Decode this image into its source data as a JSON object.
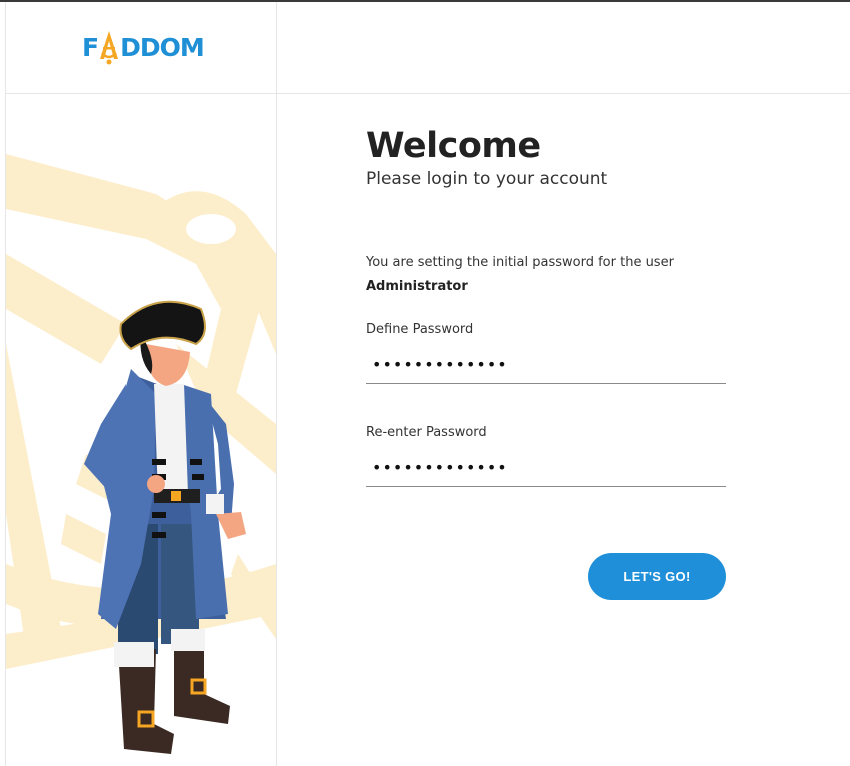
{
  "brand": {
    "logo_text_left": "F",
    "logo_text_right": "DDOM",
    "logo_alt": "FADDOM",
    "colors": {
      "blue": "#1f8fd6",
      "gold": "#f5a623",
      "illustration_bg": "#fdeecb"
    }
  },
  "login": {
    "title": "Welcome",
    "subtitle": "Please login to your account",
    "info_text": "You are setting the initial password for the user",
    "user_name": "Administrator",
    "define_password_label": "Define Password",
    "define_password_value": "•••••••••••••",
    "reenter_password_label": "Re-enter Password",
    "reenter_password_value": "•••••••••••••",
    "submit_label": "LET'S GO!"
  },
  "illustration": {
    "subject": "pirate-character",
    "background_motif": "sextant"
  },
  "accent_color": "#1e8fd8"
}
